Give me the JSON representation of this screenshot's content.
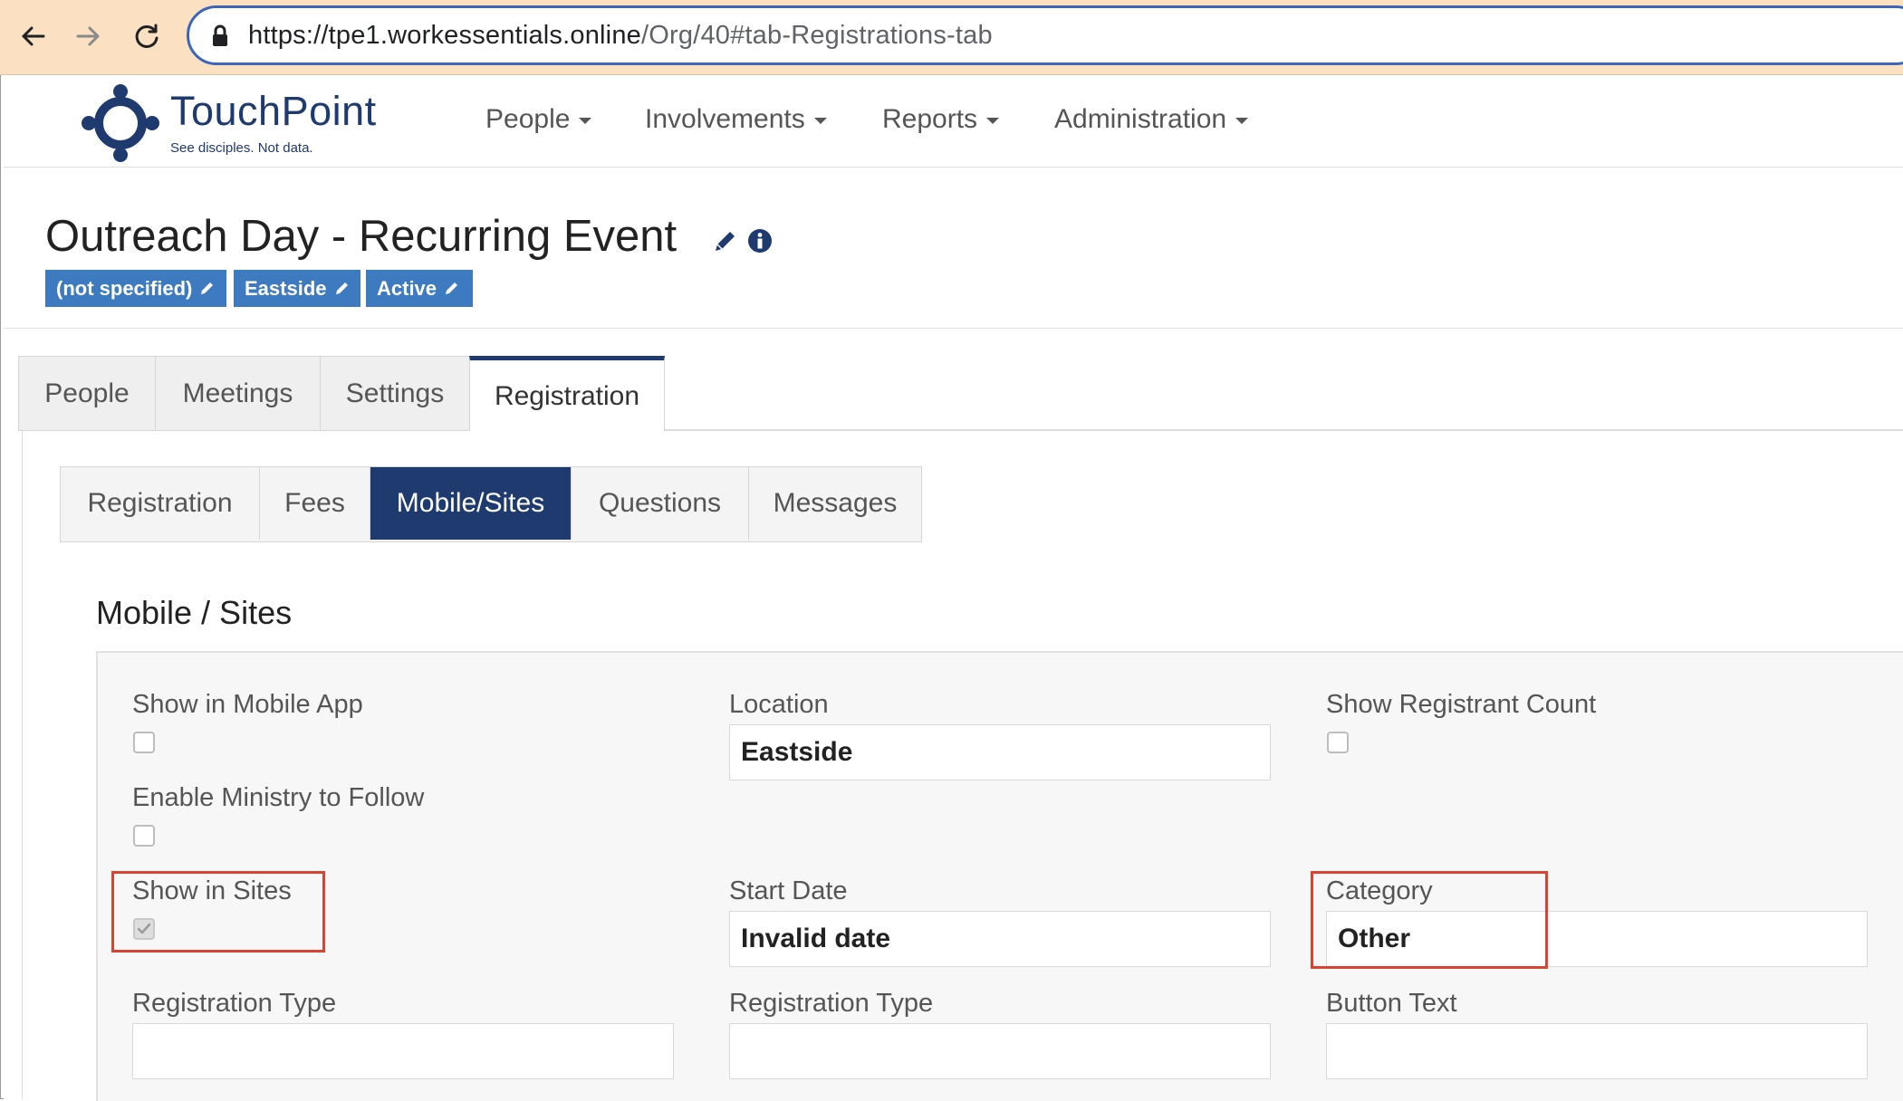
{
  "browser": {
    "url_host": "https://tpe1.workessentials.online",
    "url_path": "/Org/40#tab-Registrations-tab"
  },
  "app": {
    "brand": "TouchPoint",
    "tagline": "See disciples. Not data.",
    "nav": [
      "People",
      "Involvements",
      "Reports",
      "Administration"
    ]
  },
  "page": {
    "title": "Outreach Day - Recurring Event",
    "badges": [
      "(not specified)",
      "Eastside",
      "Active"
    ]
  },
  "main_tabs": [
    "People",
    "Meetings",
    "Settings",
    "Registration"
  ],
  "sub_tabs": [
    "Registration",
    "Fees",
    "Mobile/Sites",
    "Questions",
    "Messages"
  ],
  "section": {
    "title": "Mobile / Sites",
    "show_in_mobile_app": {
      "label": "Show in Mobile App",
      "checked": false
    },
    "enable_ministry_follow": {
      "label": "Enable Ministry to Follow",
      "checked": false
    },
    "show_in_sites": {
      "label": "Show in Sites",
      "checked": true
    },
    "registration_type_1": {
      "label": "Registration Type",
      "value": ""
    },
    "location": {
      "label": "Location",
      "value": "Eastside"
    },
    "start_date": {
      "label": "Start Date",
      "value": "Invalid date"
    },
    "registration_type_2": {
      "label": "Registration Type",
      "value": ""
    },
    "show_registrant_count": {
      "label": "Show Registrant Count",
      "checked": false
    },
    "category": {
      "label": "Category",
      "value": "Other"
    },
    "button_text": {
      "label": "Button Text",
      "value": ""
    }
  },
  "colors": {
    "brand_navy": "#1e3a6e",
    "badge_blue": "#3d7ac0",
    "highlight_red": "#d64533",
    "browser_bar": "#fbe0c2"
  }
}
